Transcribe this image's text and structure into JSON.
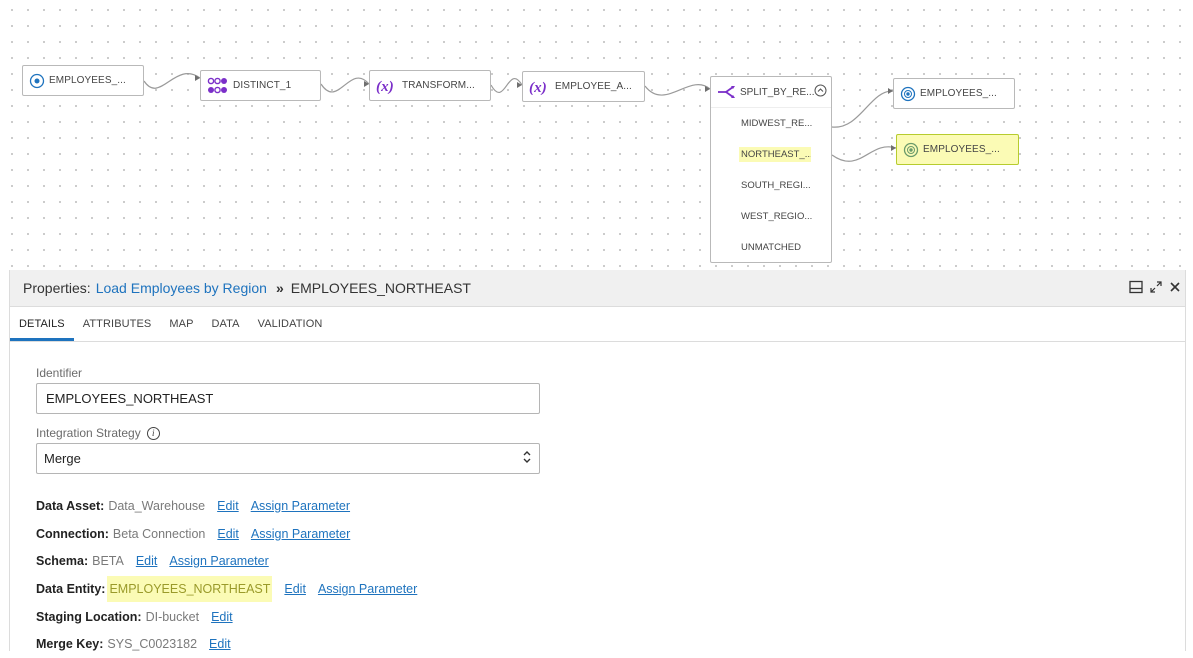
{
  "canvas": {
    "nodes": {
      "source": {
        "label": "EMPLOYEES_...",
        "icon": "source-target-icon"
      },
      "distinct": {
        "label": "DISTINCT_1",
        "icon": "distinct-icon"
      },
      "transform": {
        "label": "TRANSFORM...",
        "icon": "expression-icon"
      },
      "employee_a": {
        "label": "EMPLOYEE_A...",
        "icon": "expression-icon"
      },
      "split": {
        "label": "SPLIT_BY_RE...",
        "icon": "split-icon"
      },
      "target1": {
        "label": "EMPLOYEES_...",
        "icon": "source-target-icon"
      },
      "target2": {
        "label": "EMPLOYEES_...",
        "icon": "source-target-icon"
      }
    },
    "split_outputs": [
      "MIDWEST_RE...",
      "NORTHEAST_...",
      "SOUTH_REGI...",
      "WEST_REGIO...",
      "UNMATCHED"
    ]
  },
  "panel": {
    "prefix": "Properties:",
    "link": "Load Employees by Region",
    "separator": "»",
    "current": "EMPLOYEES_NORTHEAST",
    "tabs": [
      "DETAILS",
      "ATTRIBUTES",
      "MAP",
      "DATA",
      "VALIDATION"
    ],
    "active_tab": "DETAILS"
  },
  "details": {
    "identifier_label": "Identifier",
    "identifier_value": "EMPLOYEES_NORTHEAST",
    "strategy_label": "Integration Strategy",
    "strategy_value": "Merge",
    "properties": [
      {
        "key": "Data Asset:",
        "value": "Data_Warehouse",
        "edit": "Edit",
        "assign": "Assign Parameter"
      },
      {
        "key": "Connection:",
        "value": "Beta Connection",
        "edit": "Edit",
        "assign": "Assign Parameter"
      },
      {
        "key": "Schema:",
        "value": "BETA",
        "edit": "Edit",
        "assign": "Assign Parameter"
      },
      {
        "key": "Data Entity:",
        "value": "EMPLOYEES_NORTHEAST",
        "edit": "Edit",
        "assign": "Assign Parameter"
      },
      {
        "key": "Staging Location:",
        "value": "DI-bucket",
        "edit": "Edit"
      },
      {
        "key": "Merge Key:",
        "value": "SYS_C0023182",
        "edit": "Edit"
      }
    ]
  },
  "colors": {
    "accent": "#1e73be",
    "highlight": "#fbfbb5",
    "expression_purple": "#7b2fc9"
  }
}
